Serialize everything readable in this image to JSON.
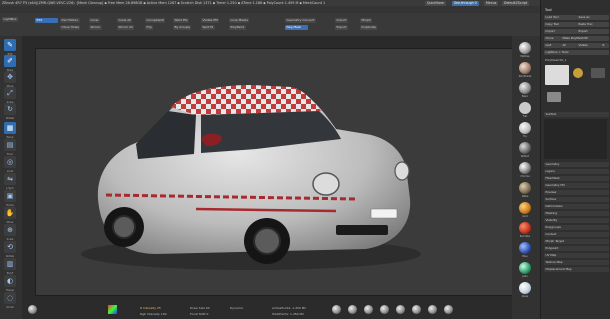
{
  "titlebar": {
    "text": "ZBrush 4R7 P3 (x64)(ZMR-QWE-VEVC-V26) ·[Mesh Cleanup] ▪ Free Mem 26.898GB ▪ Active Mem 1267 ▪ Scratch Disk 1371 ▪ Timer 1.250 ▪ ATime 1.186 ▪ PolyCount 1.459 M ▪ MeshCount 1",
    "quicksave": "QuickSave",
    "seethrough": "See-through 0",
    "menus": "Menus",
    "defaultzscript": "DefaultZScript"
  },
  "toolbar": {
    "edit": "Edit",
    "draw": "Draw",
    "move": "Move",
    "scale": "Scale",
    "rotate": "Rotate",
    "row1": [
      "Del Hidden",
      "Grow",
      "Grow All",
      "GroupsSplit",
      "Weld Pts",
      "Visible PM",
      "Loop Masks",
      "Geometry Convert"
    ],
    "row2": [
      "Close Holes",
      "Shrink",
      "Shrink All",
      "Flip",
      "By Groups",
      "Split Pt",
      "PolyPaint",
      "Neg Mask"
    ],
    "row3": [
      "Del Visible",
      "Invert",
      "Smooth",
      "Dilate",
      "Erode"
    ],
    "import": "Import",
    "export": "Export",
    "morph": "Morph",
    "duplicate": "Duplicate",
    "lightbox": "LightBox",
    "perspective": "Persp"
  },
  "left_tray": {
    "items": [
      "Edit",
      "Draw",
      "Move",
      "Scale",
      "Rotate",
      "Persp",
      "Floor",
      "Local",
      "L.Sym",
      "Frame",
      "Move",
      "Scale",
      "Rotate",
      "PolyF",
      "Transp",
      "Ghost",
      "Solo",
      "Xpose"
    ]
  },
  "right_tray": {
    "materials": [
      "MatCap",
      "SkinShade",
      "Basic",
      "Flat",
      "Toy",
      "Reflect",
      "Chrome",
      "Metal",
      "Gold",
      "Red Wax",
      "Blue",
      "Jade",
      "Glass"
    ]
  },
  "tool_panel": {
    "title": "Tool",
    "load_tool": "Load Tool",
    "save_as": "Save As",
    "copy_tool": "Copy Tool",
    "paste_tool": "Paste Tool",
    "import": "Import",
    "export": "Export",
    "clone": "Clone",
    "make_polymesh": "Make PolyMesh3D",
    "goz": "GoZ",
    "all": "All",
    "visible": "Visible",
    "r": "R",
    "lightbox_tools": "Lightbox > Tools",
    "current_tool": "PolyMesh3D_1",
    "subtool": "SubTool",
    "geometry": "Geometry",
    "layers": "Layers",
    "fibermesh": "FiberMesh",
    "geometry_hd": "Geometry HD",
    "preview": "Preview",
    "surface": "Surface",
    "deformation": "Deformation",
    "masking": "Masking",
    "visibility": "Visibility",
    "polygroups": "Polygroups",
    "contact": "Contact",
    "morph_target": "Morph Target",
    "polypaint": "Polypaint",
    "uv_map": "UV Map",
    "texture_map": "Texture Map",
    "displacement": "Displacement Map"
  },
  "bottom_bar": {
    "z_intensity": "Z Intensity 25",
    "rgb_intensity": "Rgb Intensity 100",
    "draw_size": "Draw Size 64",
    "dynamic": "Dynamic",
    "focal_shift": "Focal Shift 0",
    "active_points": "ActivePoints: 1.459 Mil",
    "total_points": "TotalPoints: 1.459 Mil"
  },
  "colors": {
    "accent": "#3a6fb5",
    "panel": "#2f2f2f",
    "canvas": "#3b3b3b"
  }
}
